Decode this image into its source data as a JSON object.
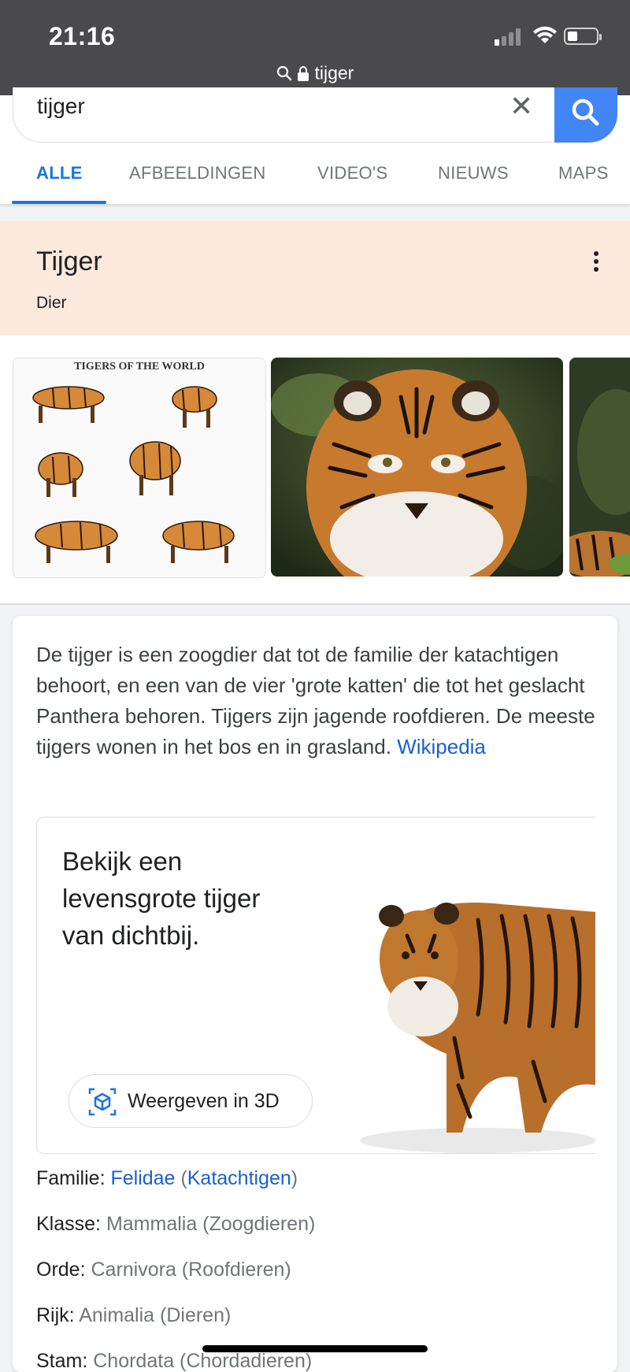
{
  "status_bar": {
    "time": "21:16",
    "url": "tijger"
  },
  "search": {
    "query": "tijger"
  },
  "tabs": [
    {
      "label": "ALLE"
    },
    {
      "label": "AFBEELDINGEN"
    },
    {
      "label": "VIDEO'S"
    },
    {
      "label": "NIEUWS"
    },
    {
      "label": "MAPS"
    }
  ],
  "knowledge_panel": {
    "title": "Tijger",
    "subtitle": "Dier",
    "image_caption": "TIGERS OF THE WORLD",
    "description": "De tijger is een zoogdier dat tot de familie der katachtigen behoort, en een van de vier 'grote katten' die tot het geslacht Panthera behoren. Tijgers zijn jagende roofdieren. De meeste tijgers wonen in het bos en in grasland.",
    "description_link": "Wikipedia",
    "ar_card": {
      "heading": "Bekijk een levensgrote tijger van dichtbij.",
      "button": "Weergeven in 3D"
    },
    "facts": [
      {
        "label": "Familie:",
        "value": "Felidae",
        "paren_open": " (",
        "extra": "Katachtigen",
        "paren_close": ")"
      },
      {
        "label": "Klasse:",
        "value": "Mammalia (Zoogdieren)"
      },
      {
        "label": "Orde:",
        "value": "Carnivora (Roofdieren)"
      },
      {
        "label": "Rijk:",
        "value": "Animalia (Dieren)"
      },
      {
        "label": "Stam:",
        "value": "Chordata (Chordadieren)"
      }
    ]
  },
  "colors": {
    "accent_blue": "#1a73e8",
    "search_button": "#4285f4",
    "panel_header_bg": "#fbe9dd",
    "panel_header_border": "#f0a36b"
  }
}
